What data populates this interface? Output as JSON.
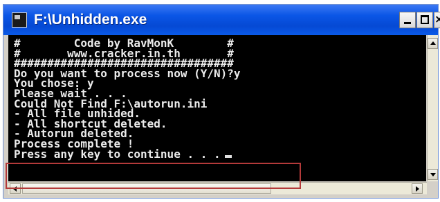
{
  "window": {
    "title": "F:\\Unhidden.exe",
    "icon": "console-app-icon",
    "controls": {
      "minimize_icon": "minimize-icon",
      "maximize_icon": "maximize-icon",
      "close_label": "×"
    }
  },
  "console": {
    "background": "#000000",
    "foreground": "#ececec",
    "lines": [
      "#        Code by RavMonK        #",
      "#       www.cracker.in.th       #",
      "#################################",
      "Do you want to process now (Y/N)?y",
      "You chose: y",
      "Please wait . . .",
      "Could Not Find F:\\autorun.ini",
      "- All file unhided.",
      "- All shortcut deleted.",
      "- Autorun deleted.",
      "Process complete !",
      "Press any key to continue . . ."
    ]
  },
  "annotation": {
    "highlight_color": "#b43a3a"
  },
  "scrollbars": {
    "vertical": {
      "up_icon": "scroll-up-icon",
      "down_icon": "scroll-down-icon"
    },
    "horizontal": {
      "left_icon": "scroll-left-icon",
      "right_icon": "scroll-right-icon"
    }
  }
}
